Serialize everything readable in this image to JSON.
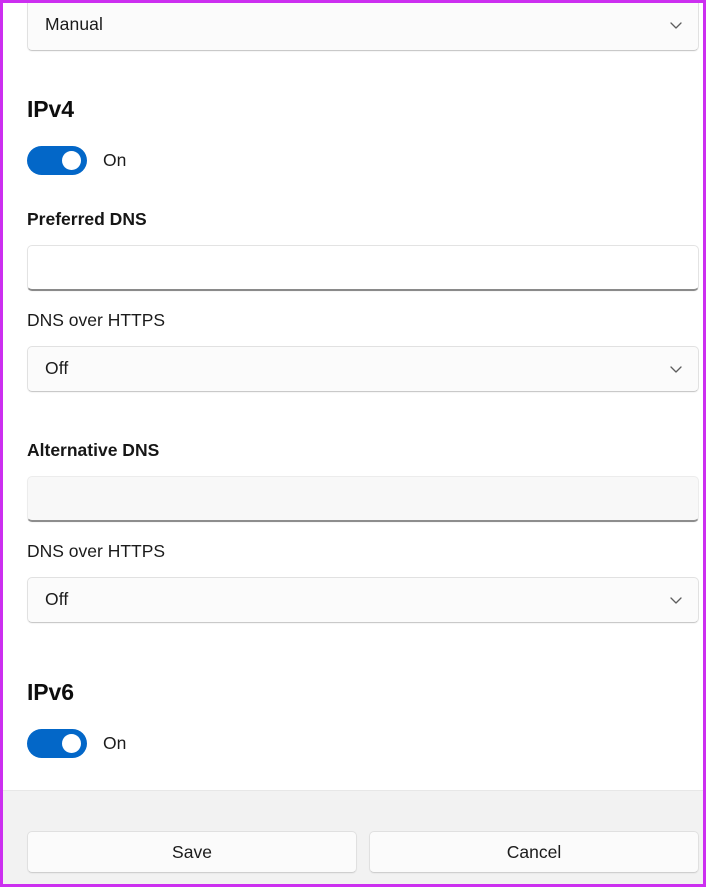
{
  "window": {
    "accent_border_color": "#cc2ff0",
    "toggle_on_color": "#0367c8",
    "footer_bg": "#f2f2f2"
  },
  "ip_assignment": {
    "value": "Manual",
    "chevron_icon": "chevron-down-icon"
  },
  "ipv4": {
    "heading": "IPv4",
    "toggle_state_label": "On",
    "preferred_dns": {
      "label": "Preferred DNS",
      "value": "",
      "placeholder": ""
    },
    "preferred_doh": {
      "label": "DNS over HTTPS",
      "value": "Off",
      "chevron_icon": "chevron-down-icon"
    },
    "alternative_dns": {
      "label": "Alternative DNS",
      "value": "",
      "placeholder": ""
    },
    "alternative_doh": {
      "label": "DNS over HTTPS",
      "value": "Off",
      "chevron_icon": "chevron-down-icon"
    }
  },
  "ipv6": {
    "heading": "IPv6",
    "toggle_state_label": "On"
  },
  "footer": {
    "save_label": "Save",
    "cancel_label": "Cancel"
  }
}
